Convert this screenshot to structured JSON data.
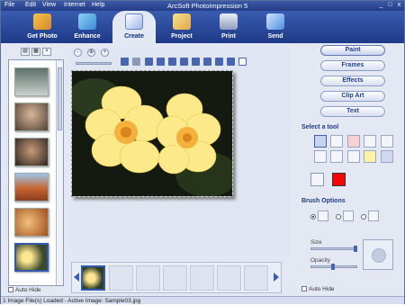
{
  "menu": {
    "file": "File",
    "edit": "Edit",
    "view": "View",
    "internet": "Internet",
    "help": "Help"
  },
  "window": {
    "title": "ArcSoft PhotoImpression 5",
    "minimize": "_",
    "maximize": "□",
    "close": "x"
  },
  "toolbar": {
    "items": [
      {
        "label": "Get Photo"
      },
      {
        "label": "Enhance"
      },
      {
        "label": "Create"
      },
      {
        "label": "Project"
      },
      {
        "label": "Print"
      },
      {
        "label": "Send"
      }
    ]
  },
  "left_panel": {
    "auto_hide": "Auto Hide"
  },
  "center": {
    "zoom_out": "-",
    "zoom_in": "+"
  },
  "right_panel": {
    "buttons": {
      "paint": "Paint",
      "frames": "Frames",
      "effects": "Effects",
      "clip_art": "Clip Art",
      "text": "Text"
    },
    "select_tool": "Select a tool",
    "brush_options": "Brush Options",
    "size": "Size",
    "opacity": "Opacity",
    "auto_hide": "Auto Hide",
    "current_color": "#ff0000",
    "size_level": 0.95,
    "opacity_level": 0.45
  },
  "status": {
    "text": "1 Image File(s) Loaded - Active Image: Sample03.jpg"
  },
  "colors": {
    "toolbar": "#2a4a9c",
    "panel": "#e3e8f2",
    "accent": "#23408f"
  }
}
